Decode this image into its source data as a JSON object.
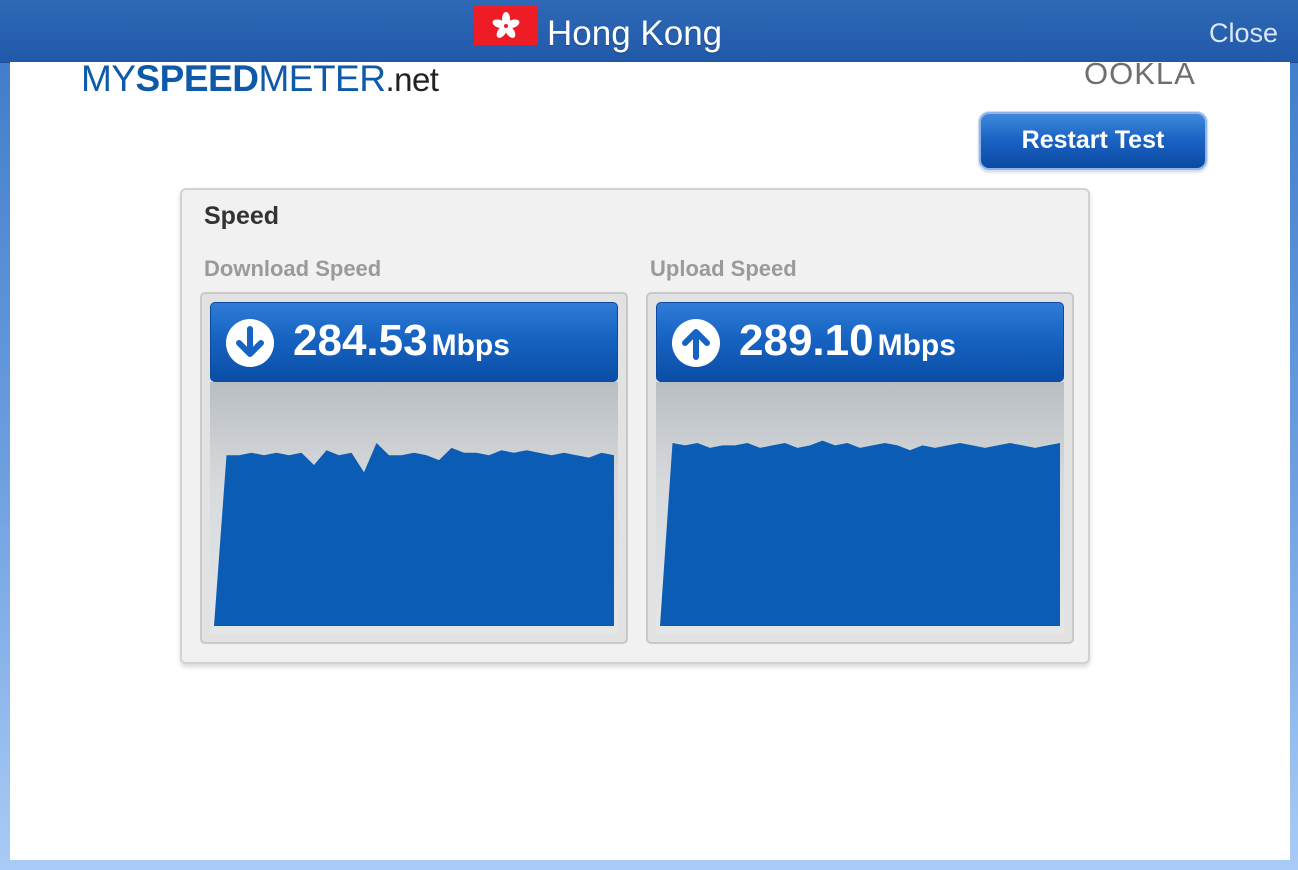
{
  "titlebar": {
    "title": "Hong Kong",
    "close_label": "Close"
  },
  "logo": {
    "part1": "MY",
    "part2": "SPEED",
    "part3": "METER",
    "part4": ".net"
  },
  "ookla_logo": "OOKLA",
  "restart_label": "Restart Test",
  "speed_section": {
    "title": "Speed",
    "download": {
      "label": "Download Speed",
      "value": "284.53",
      "unit": "Mbps"
    },
    "upload": {
      "label": "Upload Speed",
      "value": "289.10",
      "unit": "Mbps"
    }
  },
  "colors": {
    "accent": "#0a5cb4",
    "flag_red": "#ee1c25",
    "title_bar": "#2059a8"
  },
  "icons": {
    "download": "arrow-down-circle-icon",
    "upload": "arrow-up-circle-icon",
    "flag": "hong-kong-flag-icon"
  },
  "chart_data": [
    {
      "type": "area",
      "name": "download",
      "series": [
        {
          "values": [
            0,
            0.7,
            0.7,
            0.71,
            0.7,
            0.71,
            0.7,
            0.71,
            0.66,
            0.72,
            0.7,
            0.71,
            0.63,
            0.75,
            0.7,
            0.7,
            0.71,
            0.7,
            0.68,
            0.73,
            0.71,
            0.71,
            0.7,
            0.72,
            0.71,
            0.72,
            0.71,
            0.7,
            0.71,
            0.7,
            0.69,
            0.71,
            0.7
          ]
        }
      ],
      "ylim": [
        0,
        1
      ]
    },
    {
      "type": "area",
      "name": "upload",
      "series": [
        {
          "values": [
            0,
            0.75,
            0.74,
            0.75,
            0.73,
            0.74,
            0.74,
            0.75,
            0.73,
            0.74,
            0.75,
            0.73,
            0.74,
            0.76,
            0.74,
            0.75,
            0.73,
            0.74,
            0.75,
            0.74,
            0.72,
            0.74,
            0.73,
            0.74,
            0.75,
            0.74,
            0.73,
            0.74,
            0.75,
            0.74,
            0.73,
            0.74,
            0.75
          ]
        }
      ],
      "ylim": [
        0,
        1
      ]
    }
  ]
}
